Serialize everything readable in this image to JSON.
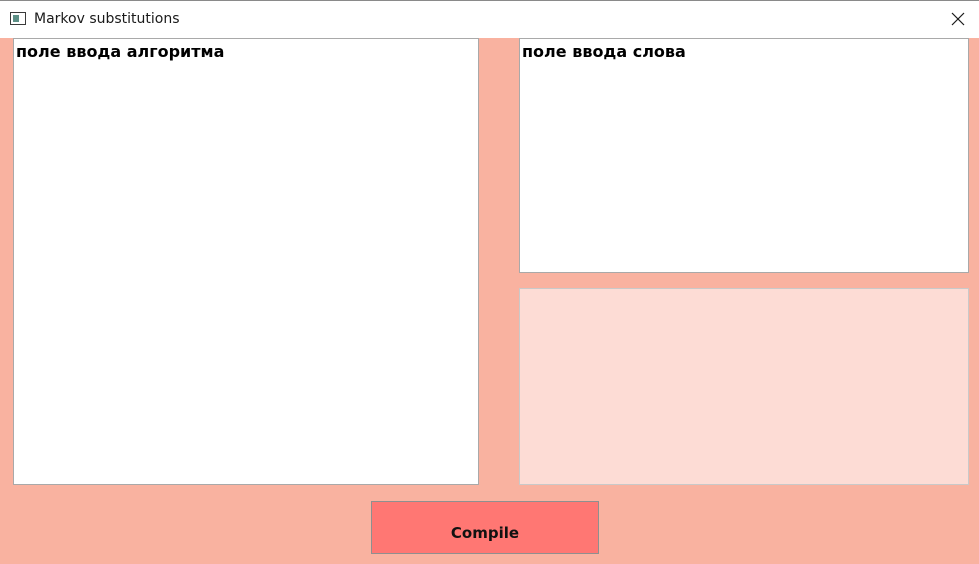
{
  "window": {
    "title": "Markov substitutions",
    "app_icon": "window-icon",
    "close_icon": "close-icon"
  },
  "algorithm_input": {
    "text": "поле ввода алгоритма"
  },
  "word_input": {
    "text": "поле ввода слова"
  },
  "output": {
    "text": ""
  },
  "compile_button": {
    "label": "Compile"
  },
  "colors": {
    "background": "#f9b2a0",
    "output_background": "#fddcd5",
    "button": "#ff7773"
  }
}
